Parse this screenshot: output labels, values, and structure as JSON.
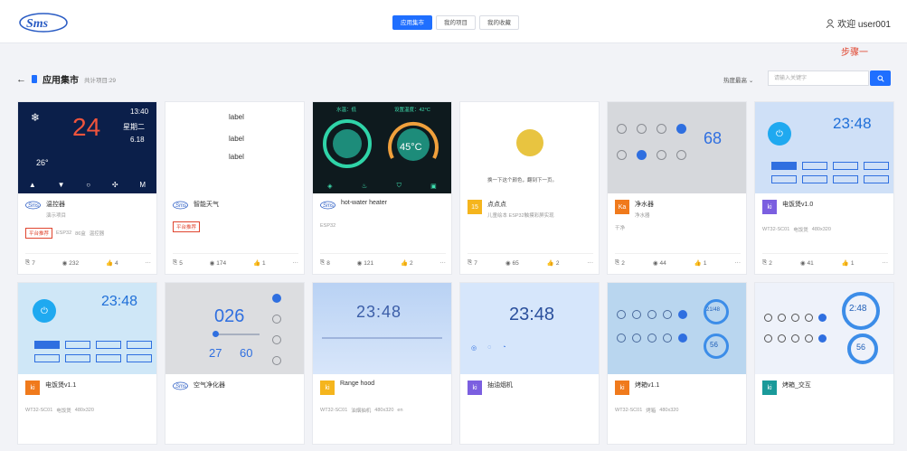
{
  "header": {
    "tabs": [
      {
        "label": "应用集市",
        "active": true
      },
      {
        "label": "我的项目",
        "active": false
      },
      {
        "label": "我的收藏",
        "active": false
      }
    ],
    "user_label": "欢迎 user001",
    "step_label": "步骤一"
  },
  "page": {
    "title": "应用集市",
    "total": "共计项目:29",
    "sort_label": "热度最高",
    "search_placeholder": "请输入关键字"
  },
  "cards": [
    {
      "title": "温控器",
      "subtitle": "演示项目",
      "tags": [
        "平台推荐",
        "ESP32",
        "86盒",
        "温控器"
      ],
      "views": "232",
      "likes": "4",
      "copies": "7",
      "thumb_text": {
        "temp": "24",
        "time": "13:40",
        "week": "星期二",
        "date": "6.18",
        "room": "26°",
        "mode": "M"
      }
    },
    {
      "title": "智能天气",
      "subtitle": "",
      "tags": [
        "平台推荐"
      ],
      "views": "174",
      "likes": "1",
      "copies": "5",
      "thumb_text": {
        "l1": "label",
        "l2": "label",
        "l3": "label"
      }
    },
    {
      "title": "hot-water heater",
      "subtitle": "",
      "tags": [
        "ESP32"
      ],
      "views": "121",
      "likes": "2",
      "copies": "8",
      "thumb_text": {
        "water": "水温：低",
        "set": "设置温度：42°C",
        "temp": "45°C"
      }
    },
    {
      "title": "点点点",
      "subtitle": "儿童绘本 ESP32触摸彩屏实现",
      "badge": "15",
      "badge_color": "#f5b51d",
      "tags": [],
      "views": "65",
      "likes": "2",
      "copies": "7",
      "thumb_text": {
        "hint": "换一下这个颜色，翻到下一页。"
      }
    },
    {
      "title": "净水器",
      "subtitle": "净水器",
      "badge": "Ka",
      "badge_color": "#f07a1c",
      "tags": [
        "干净"
      ],
      "views": "44",
      "likes": "1",
      "copies": "2",
      "thumb_text": {
        "num": "68"
      }
    },
    {
      "title": "电饭煲v1.0",
      "subtitle": "",
      "badge": "ki",
      "badge_color": "#7b5fe0",
      "tags": [
        "WT32-SC01",
        "电饭煲",
        "480x320"
      ],
      "views": "41",
      "likes": "1",
      "copies": "2",
      "thumb_text": {
        "time": "23:48"
      }
    },
    {
      "title": "电饭煲v1.1",
      "subtitle": "",
      "badge": "ki",
      "badge_color": "#f07a1c",
      "tags": [
        "WT32-SC01",
        "电饭煲",
        "480x320"
      ],
      "thumb_text": {
        "time": "23:48"
      }
    },
    {
      "title": "空气净化器",
      "subtitle": "",
      "tags": [],
      "thumb_text": {
        "num": "026",
        "t": "27",
        "h": "60"
      }
    },
    {
      "title": "Range hood",
      "subtitle": "",
      "badge": "ki",
      "badge_color": "#f5b51d",
      "tags": [
        "WT32-SC01",
        "油烟抽机",
        "480x320",
        "en"
      ],
      "thumb_text": {
        "time": "23:48"
      }
    },
    {
      "title": "抽油烟机",
      "subtitle": "",
      "badge": "ki",
      "badge_color": "#7b5fe0",
      "tags": [],
      "thumb_text": {
        "time": "23:48"
      }
    },
    {
      "title": "烤箱v1.1",
      "subtitle": "",
      "badge": "ki",
      "badge_color": "#f07a1c",
      "tags": [
        "WT32-SC01",
        "烤箱",
        "480x320"
      ],
      "thumb_text": {
        "a": "21/48",
        "b": "56"
      }
    },
    {
      "title": "烤箱_交互",
      "subtitle": "",
      "badge": "ki",
      "badge_color": "#1a9a9a",
      "tags": [],
      "thumb_text": {
        "a": "2:48",
        "b": "56"
      }
    }
  ]
}
